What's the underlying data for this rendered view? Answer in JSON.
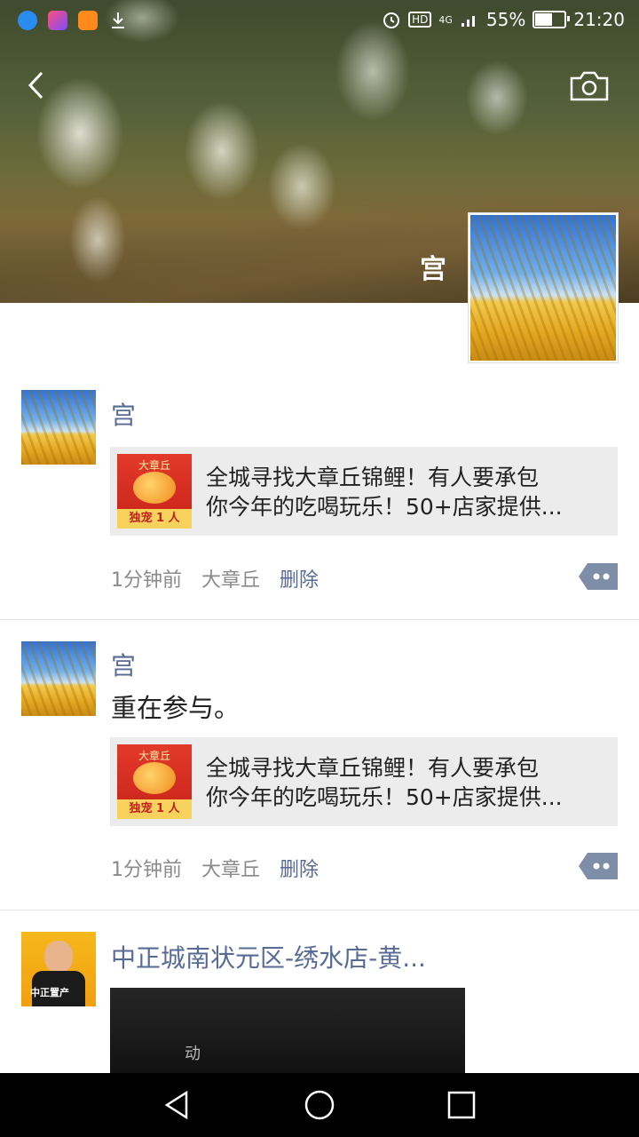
{
  "statusbar": {
    "icons": [
      "qq-browser-icon",
      "video-app-icon",
      "huya-icon",
      "download-icon"
    ],
    "network": "4G",
    "battery_percent": "55%",
    "time": "21:20"
  },
  "cover": {
    "user_name": "宫"
  },
  "posts": [
    {
      "author": "宫",
      "text": "",
      "card": {
        "thumb_label_top": "大章丘",
        "thumb_label_bottom": "独宠 1 人",
        "line1": "全城寻找大章丘锦鲤！有人要承包",
        "line2": "你今年的吃喝玩乐！50+店家提供..."
      },
      "time": "1分钟前",
      "location": "大章丘",
      "delete_label": "删除"
    },
    {
      "author": "宫",
      "text": "重在参与。",
      "card": {
        "thumb_label_top": "大章丘",
        "thumb_label_bottom": "独宠 1 人",
        "line1": "全城寻找大章丘锦鲤！有人要承包",
        "line2": "你今年的吃喝玩乐！50+店家提供..."
      },
      "time": "1分钟前",
      "location": "大章丘",
      "delete_label": "删除"
    },
    {
      "author": "中正城南状元区-绣水店-黄...",
      "avatar_label": "中正置产",
      "video_caption": "动"
    }
  ],
  "colors": {
    "name_link": "#576b95",
    "card_bg": "#ececec",
    "meta_text": "#8a8a8a"
  }
}
